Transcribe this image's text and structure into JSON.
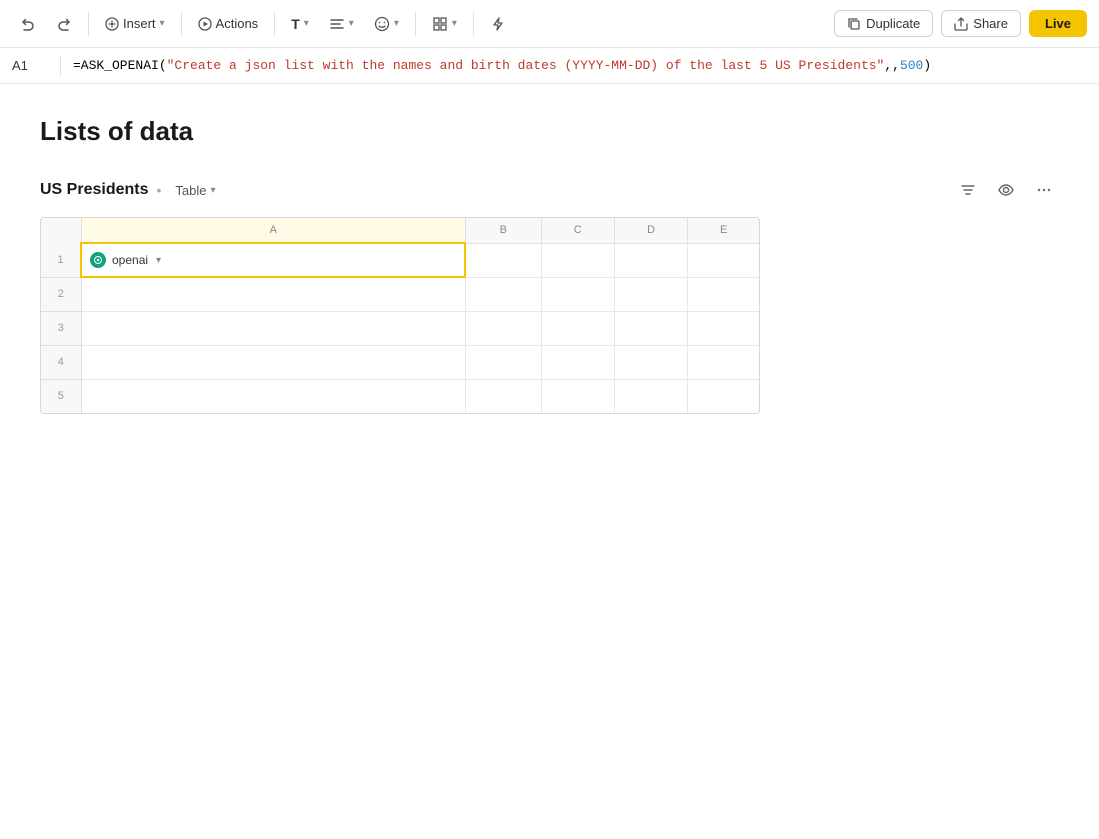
{
  "toolbar": {
    "undo_label": "↺",
    "redo_label": "↻",
    "insert_label": "Insert",
    "actions_label": "Actions",
    "text_label": "T",
    "align_label": "≡",
    "emoji_label": "☺",
    "grid_label": "⊞",
    "flash_label": "⚡",
    "duplicate_label": "Duplicate",
    "share_label": "Share",
    "live_label": "Live"
  },
  "formula_bar": {
    "cell_ref": "A1",
    "formula": "=ASK_OPENAI(\"Create a json list with the names and birth dates (YYYY-MM-DD) of the last 5 US Presidents\",,500)"
  },
  "page": {
    "title": "Lists of data"
  },
  "table_section": {
    "title": "US Presidents",
    "view_label": "Table",
    "columns": [
      "A",
      "B",
      "C",
      "D",
      "E"
    ],
    "rows": [
      1,
      2,
      3,
      4,
      5
    ],
    "cell_a1_label": "openai",
    "filter_icon": "filter",
    "eye_icon": "eye",
    "more_icon": "more"
  }
}
